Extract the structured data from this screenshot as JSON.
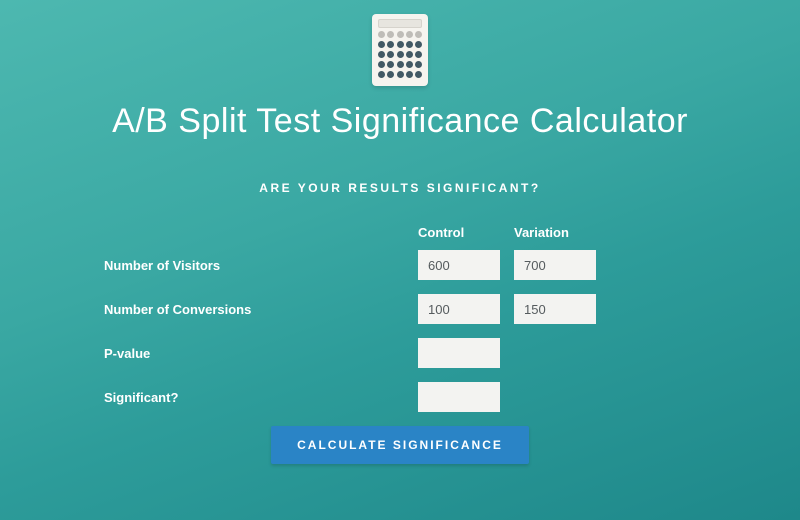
{
  "header": {
    "title": "A/B Split Test Significance Calculator",
    "subtitle": "ARE YOUR RESULTS SIGNIFICANT?"
  },
  "columns": {
    "control": "Control",
    "variation": "Variation"
  },
  "rows": {
    "visitors": {
      "label": "Number of Visitors",
      "control": "600",
      "variation": "700"
    },
    "conversions": {
      "label": "Number of Conversions",
      "control": "100",
      "variation": "150"
    },
    "pvalue": {
      "label": "P-value",
      "control": "",
      "variation": ""
    },
    "significant": {
      "label": "Significant?",
      "control": "",
      "variation": ""
    }
  },
  "actions": {
    "calculate_label": "CALCULATE SIGNIFICANCE"
  },
  "icon": {
    "name": "calculator"
  }
}
